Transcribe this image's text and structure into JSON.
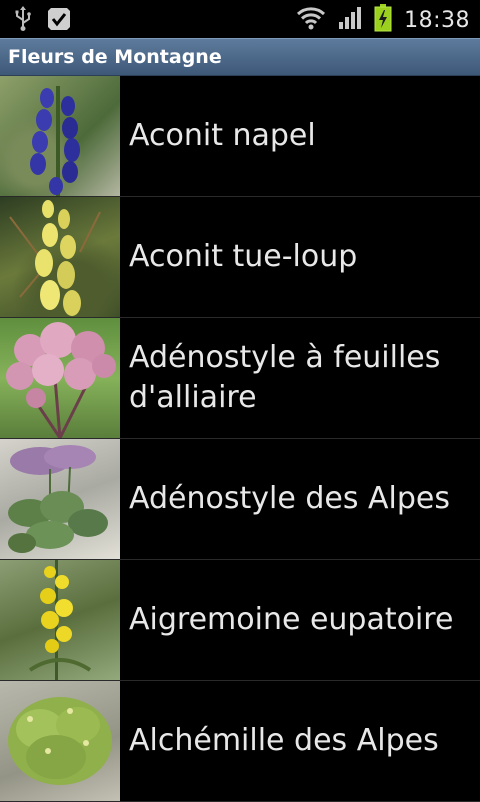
{
  "status_bar": {
    "time": "18:38",
    "icons": [
      "usb-icon",
      "check-icon",
      "wifi-icon",
      "signal-icon",
      "battery-charging-icon"
    ]
  },
  "app": {
    "title": "Fleurs de Montagne"
  },
  "list": {
    "items": [
      {
        "name": "Aconit napel",
        "thumb": "purple-flower-thumbnail"
      },
      {
        "name": "Aconit tue-loup",
        "thumb": "yellow-flower-thumbnail"
      },
      {
        "name": "Adénostyle à feuilles d'alliaire",
        "thumb": "pink-flower-thumbnail"
      },
      {
        "name": "Adénostyle des Alpes",
        "thumb": "rock-plant-thumbnail"
      },
      {
        "name": "Aigremoine eupatoire",
        "thumb": "yellow-spike-thumbnail"
      },
      {
        "name": "Alchémille des Alpes",
        "thumb": "green-shrub-thumbnail"
      }
    ]
  }
}
